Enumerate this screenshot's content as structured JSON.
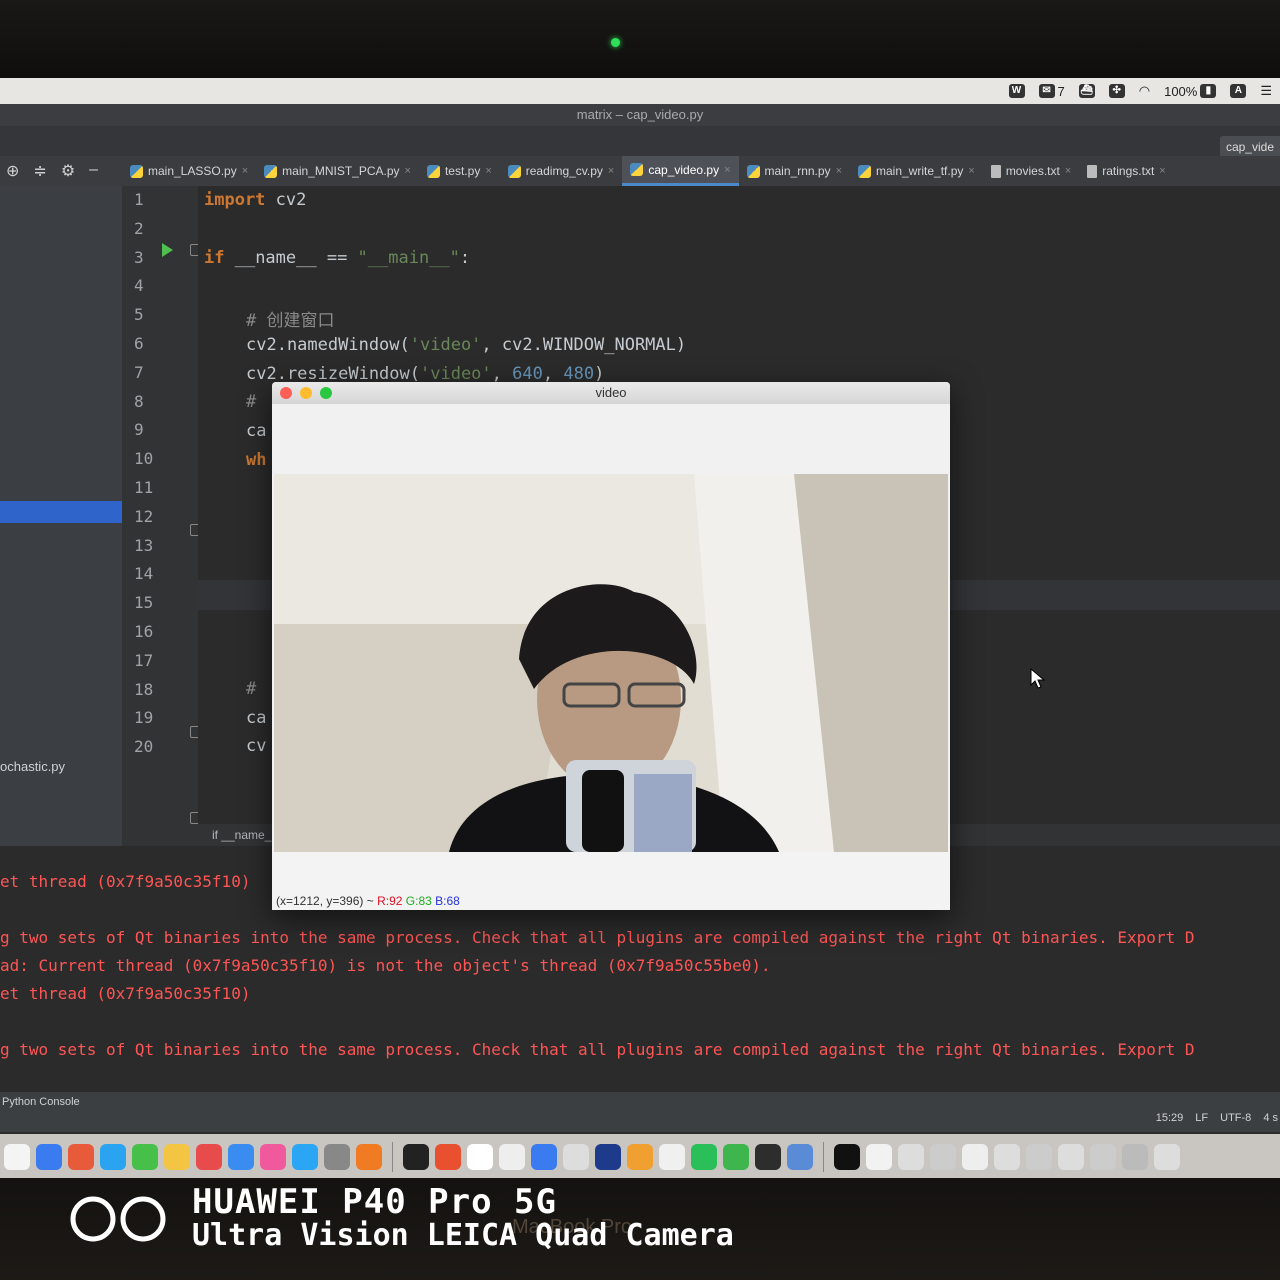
{
  "menubar": {
    "wechat_count": "7",
    "battery": "100%",
    "input_method": "A"
  },
  "window": {
    "title": "matrix – cap_video.py",
    "right_tab": "cap_vide"
  },
  "tabs": [
    {
      "label": "main_LASSO.py",
      "type": "py"
    },
    {
      "label": "main_MNIST_PCA.py",
      "type": "py"
    },
    {
      "label": "test.py",
      "type": "py"
    },
    {
      "label": "readimg_cv.py",
      "type": "py"
    },
    {
      "label": "cap_video.py",
      "type": "py",
      "active": true
    },
    {
      "label": "main_rnn.py",
      "type": "py"
    },
    {
      "label": "main_write_tf.py",
      "type": "py"
    },
    {
      "label": "movies.txt",
      "type": "txt"
    },
    {
      "label": "ratings.txt",
      "type": "txt"
    }
  ],
  "project": {
    "visible_file": "ochastic.py"
  },
  "line_numbers": [
    "1",
    "2",
    "3",
    "4",
    "5",
    "6",
    "7",
    "8",
    "9",
    "10",
    "11",
    "12",
    "13",
    "14",
    "15",
    "16",
    "17",
    "18",
    "19",
    "20"
  ],
  "code": {
    "l1_kw": "import",
    "l1_rest": " cv2",
    "l3_kw": "if",
    "l3_a": " __name__ == ",
    "l3_str": "\"__main__\"",
    "l3_b": ":",
    "l5": "# 创建窗口",
    "l6_a": "cv2.namedWindow(",
    "l6_str": "'video'",
    "l6_b": ", cv2.WINDOW_NORMAL)",
    "l7_a": "cv2.resizeWindow(",
    "l7_str": "'video'",
    "l7_b": ", ",
    "l7_n1": "640",
    "l7_c": ", ",
    "l7_n2": "480",
    "l7_d": ")",
    "l8": "#",
    "l9": "ca",
    "l10": "wh",
    "l18": "#",
    "l19": "ca",
    "l20": "cv"
  },
  "breadcrumb": "if __name_",
  "console": {
    "lines": [
      "et thread (0x7f9a50c35f10)",
      "g two sets of Qt binaries into the same process. Check that all plugins are compiled against the right Qt binaries. Export D",
      "ad: Current thread (0x7f9a50c35f10) is not the object's thread (0x7f9a50c55be0).",
      "et thread (0x7f9a50c35f10)",
      "g two sets of Qt binaries into the same process. Check that all plugins are compiled against the right Qt binaries. Export D"
    ]
  },
  "statusbar": {
    "python_console": "Python Console",
    "time": "15:29",
    "line_sep": "LF",
    "encoding": "UTF-8",
    "indent": "4 s"
  },
  "video_window": {
    "title": "video",
    "status_pos": "(x=1212, y=396) ~ ",
    "r": "R:92",
    "g": "G:83",
    "b": "B:68"
  },
  "watermark": {
    "line1": "HUAWEI P40 Pro 5G",
    "line2": "Ultra Vision LEICA Quad Camera",
    "macbook": "MacBook Pro"
  },
  "colors": {
    "keyword": "#cc7832",
    "string": "#6a8759",
    "number": "#6897bb",
    "error": "#ff5555"
  }
}
